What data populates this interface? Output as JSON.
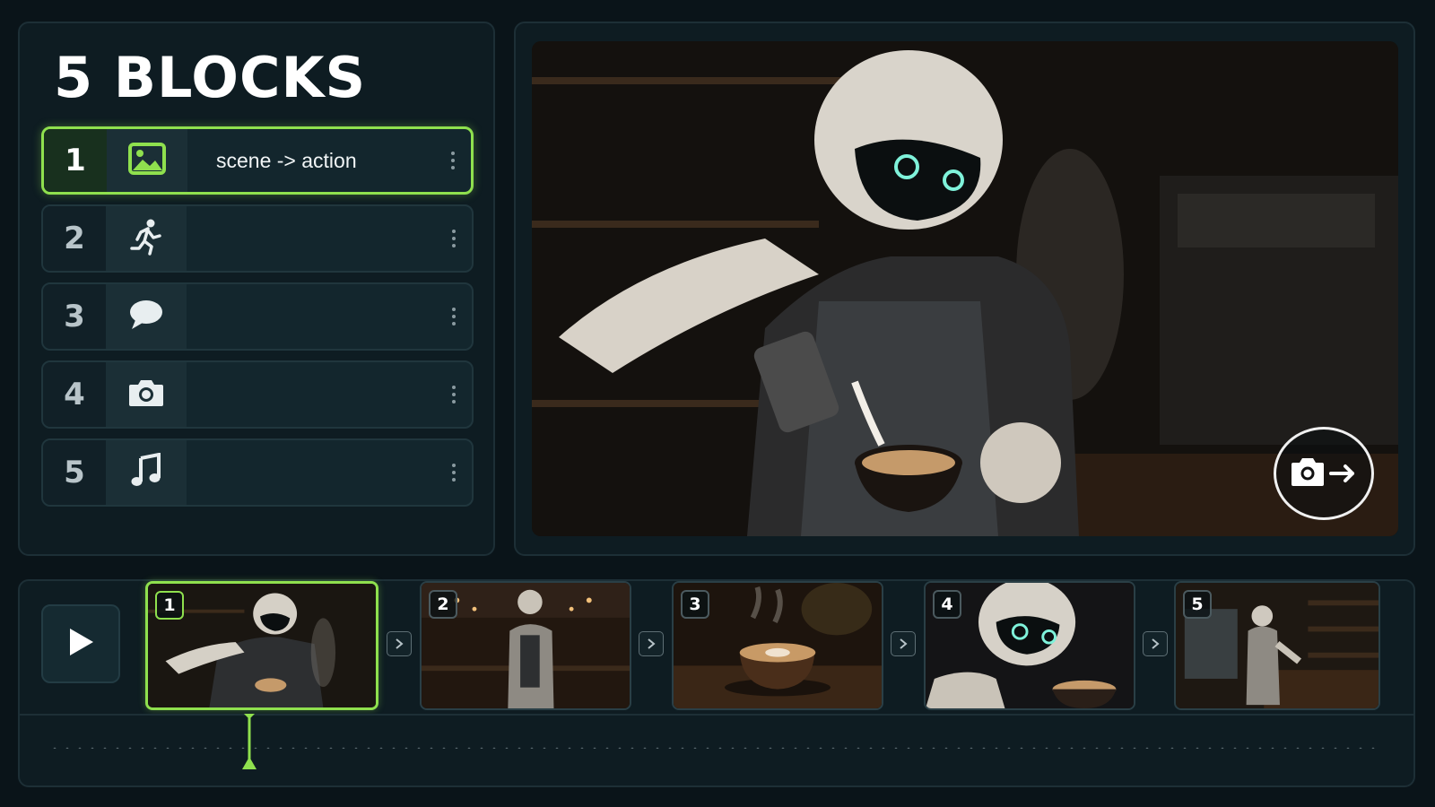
{
  "header": {
    "title": "5 BLOCKS"
  },
  "blocks": [
    {
      "number": "1",
      "icon": "image-icon",
      "label": "scene -> action",
      "active": true
    },
    {
      "number": "2",
      "icon": "running-person-icon",
      "label": "",
      "active": false
    },
    {
      "number": "3",
      "icon": "speech-bubble-icon",
      "label": "",
      "active": false
    },
    {
      "number": "4",
      "icon": "camera-icon",
      "label": "",
      "active": false
    },
    {
      "number": "5",
      "icon": "music-note-icon",
      "label": "",
      "active": false
    }
  ],
  "viewer": {
    "image": "robot-barista-pouring-milk",
    "capture_icon": "camera-arrow-icon"
  },
  "timeline": {
    "play_icon": "play-icon",
    "clips": [
      {
        "number": "1",
        "image": "robot-pouring-latte",
        "active": true
      },
      {
        "number": "2",
        "image": "robot-back-view-cafe",
        "active": false
      },
      {
        "number": "3",
        "image": "latte-cup-steam",
        "active": false
      },
      {
        "number": "4",
        "image": "robot-closeup-cup",
        "active": false
      },
      {
        "number": "5",
        "image": "robot-at-counter",
        "active": false
      }
    ],
    "playhead_clip": 1
  },
  "colors": {
    "accent": "#8fe04e",
    "background": "#0a1419",
    "panel": "#0e1c22"
  }
}
